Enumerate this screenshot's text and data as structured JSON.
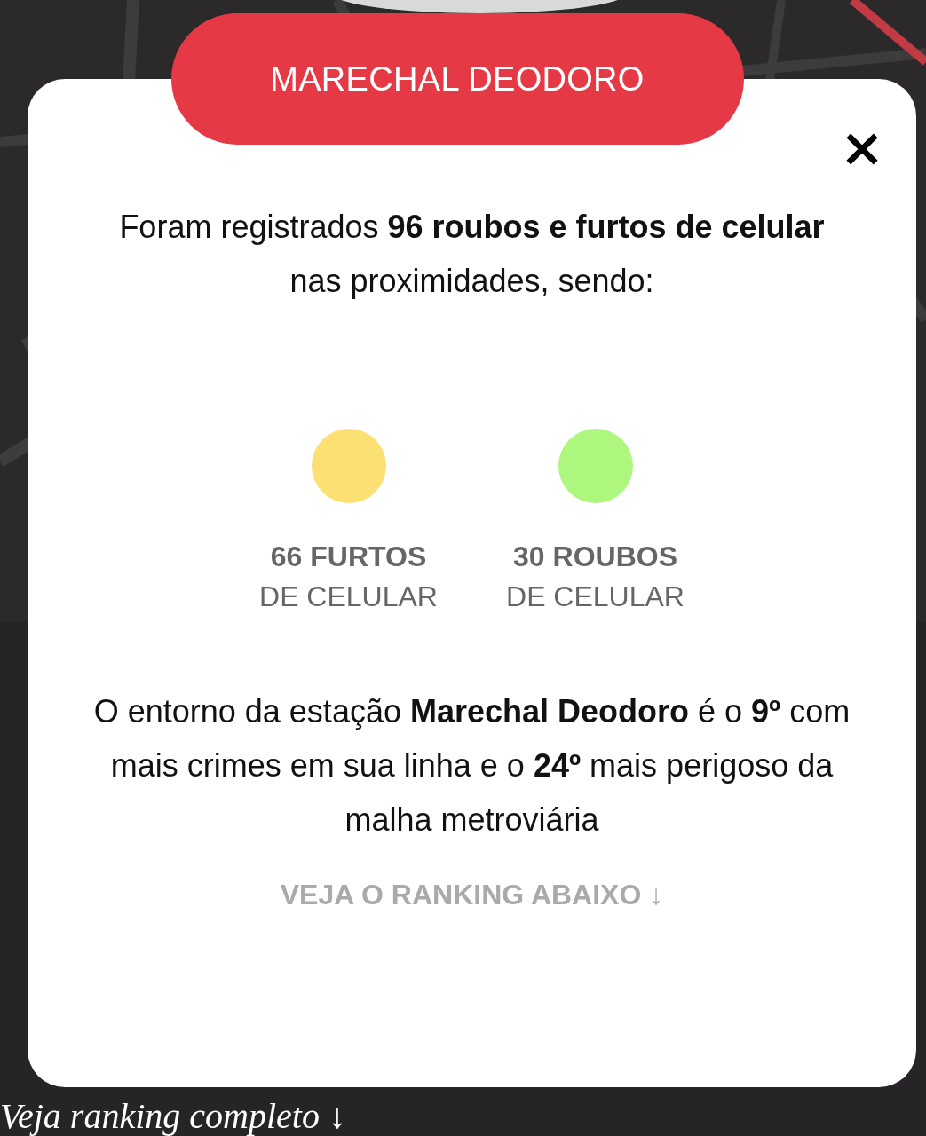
{
  "station": {
    "name": "MARECHAL DEODORO"
  },
  "intro": "Foram registrados **96 roubos e furtos de celular** nas proximidades, sendo:",
  "stats": [
    {
      "count": "66 FURTOS",
      "label": "DE CELULAR",
      "color": "#fde073"
    },
    {
      "count": "30 ROUBOS",
      "label": "DE CELULAR",
      "color": "#adf77f"
    }
  ],
  "summary": "O entorno da estação **Marechal Deodoro** é o **9º** com mais crimes em sua linha e o **24º** mais perigoso da malha metroviária",
  "ranking_link": "VEJA O RANKING ABAIXO ↓",
  "footer_heading": "Veja ranking completo ↓"
}
